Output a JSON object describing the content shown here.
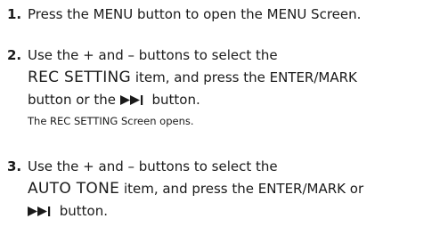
{
  "steps": [
    {
      "number": "1.",
      "lines": [
        "Press the MENU button to open the MENU Screen."
      ]
    },
    {
      "number": "2.",
      "line1": "Use the + and – buttons to select the",
      "line2_caps": "REC SETTING",
      "line2_rest": " item, and press the ENTER/MARK",
      "line3_text": "button or the ",
      "line3_icon": "skip-forward-icon",
      "line3_end": " button.",
      "result": "The REC SETTING Screen opens."
    },
    {
      "number": "3.",
      "line1": "Use the + and – buttons to select the",
      "line2_caps": "AUTO TONE",
      "line2_rest": " item, and press the ENTER/MARK or",
      "line3_icon": "skip-forward-icon",
      "line3_end": " button."
    }
  ]
}
